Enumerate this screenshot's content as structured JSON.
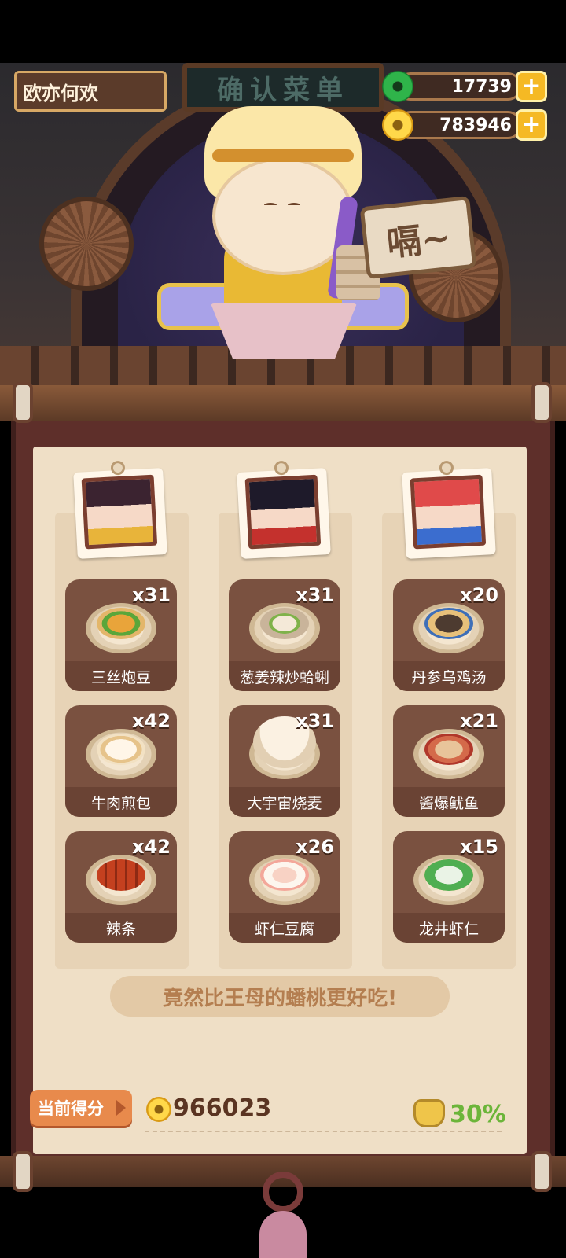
{
  "player": {
    "name": "欧亦何欢"
  },
  "currencies": [
    {
      "name": "jade",
      "value": "17739",
      "plus": "+"
    },
    {
      "name": "coin",
      "value": "783946",
      "plus": "+"
    }
  ],
  "scene": {
    "plaque": "确认菜单",
    "speech": "嗝~"
  },
  "customers": [
    {
      "dishes": [
        {
          "name": "三丝炮豆",
          "count": "x31"
        },
        {
          "name": "牛肉煎包",
          "count": "x42"
        },
        {
          "name": "辣条",
          "count": "x42"
        }
      ]
    },
    {
      "dishes": [
        {
          "name": "葱姜辣炒蛤蜊",
          "count": "x31"
        },
        {
          "name": "大宇宙烧麦",
          "count": "x31"
        },
        {
          "name": "虾仁豆腐",
          "count": "x26"
        }
      ]
    },
    {
      "dishes": [
        {
          "name": "丹参乌鸡汤",
          "count": "x20"
        },
        {
          "name": "酱爆鱿鱼",
          "count": "x21"
        },
        {
          "name": "龙井虾仁",
          "count": "x15"
        }
      ]
    }
  ],
  "comment": "竟然比王母的蟠桃更好吃!",
  "score": {
    "label": "当前得分",
    "value": "966023",
    "bonus": "30%"
  },
  "colors": {
    "accent_plus": "#f5b924",
    "bonus_green": "#6cb53a",
    "board_brown": "#7a5140"
  }
}
